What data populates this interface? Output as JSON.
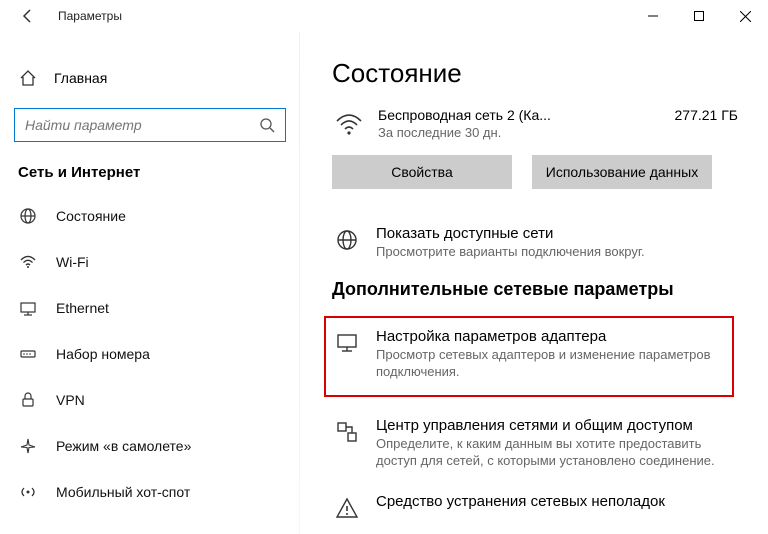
{
  "titlebar": {
    "title": "Параметры"
  },
  "sidebar": {
    "home": "Главная",
    "search_placeholder": "Найти параметр",
    "section": "Сеть и Интернет",
    "items": [
      {
        "label": "Состояние"
      },
      {
        "label": "Wi-Fi"
      },
      {
        "label": "Ethernet"
      },
      {
        "label": "Набор номера"
      },
      {
        "label": "VPN"
      },
      {
        "label": "Режим «в самолете»"
      },
      {
        "label": "Мобильный хот-спот"
      }
    ]
  },
  "main": {
    "page_title": "Состояние",
    "network": {
      "name": "Беспроводная сеть 2 (Ка...",
      "sub": "За последние 30 дн.",
      "usage": "277.21 ГБ"
    },
    "buttons": {
      "properties": "Свойства",
      "data_usage": "Использование данных"
    },
    "available": {
      "title": "Показать доступные сети",
      "desc": "Просмотрите варианты подключения вокруг."
    },
    "advanced_header": "Дополнительные сетевые параметры",
    "adapter": {
      "title": "Настройка параметров адаптера",
      "desc": "Просмотр сетевых адаптеров и изменение параметров подключения."
    },
    "sharing": {
      "title": "Центр управления сетями и общим доступом",
      "desc": "Определите, к каким данным вы хотите предоставить доступ для сетей, с которыми установлено соединение."
    },
    "troubleshoot": {
      "title": "Средство устранения сетевых неполадок"
    }
  }
}
